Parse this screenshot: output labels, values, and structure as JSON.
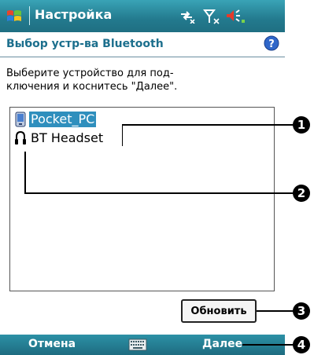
{
  "titlebar": {
    "title": "Настройка",
    "icons": [
      "windows-start-icon",
      "connectivity-icon",
      "signal-icon",
      "volume-icon"
    ]
  },
  "header": {
    "title": "Выбор устр-ва Bluetooth",
    "help_icon": "help-icon"
  },
  "instructions": {
    "line1": "Выберите устройство для под-",
    "line2": "ключения и коснитесь \"Далее\"."
  },
  "device_list": {
    "items": [
      {
        "label": "Pocket_PC",
        "icon": "pocket-pc-icon",
        "selected": true
      },
      {
        "label": "BT Headset",
        "icon": "headset-icon",
        "selected": false
      }
    ]
  },
  "buttons": {
    "refresh": "Обновить"
  },
  "bottombar": {
    "left": "Отмена",
    "right": "Далее",
    "center_icon": "keyboard-icon"
  },
  "callouts": [
    "1",
    "2",
    "3",
    "4"
  ],
  "colors": {
    "titlebar": "#237a8e",
    "header_text": "#1c6f8d",
    "selection": "#2f8fbd"
  }
}
